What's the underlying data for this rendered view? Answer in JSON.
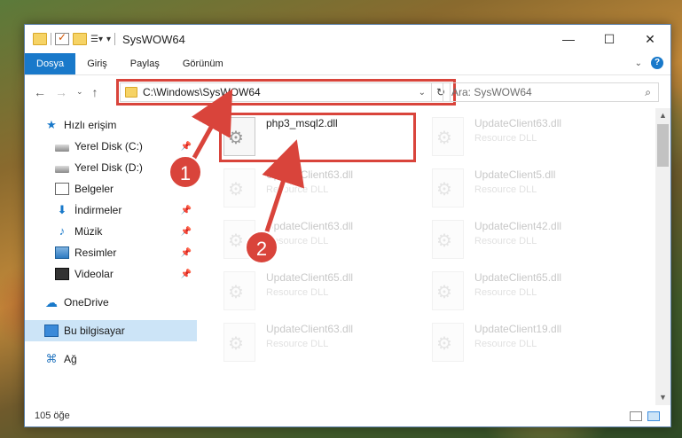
{
  "window": {
    "title": "SysWOW64"
  },
  "ribbon": {
    "tabs": [
      "Dosya",
      "Giriş",
      "Paylaş",
      "Görünüm"
    ],
    "help": "?"
  },
  "address": {
    "path": "C:\\Windows\\SysWOW64"
  },
  "search": {
    "placeholder": "Ara: SysWOW64"
  },
  "sidebar": {
    "items": [
      {
        "label": "Hızlı erişim",
        "icon": "star-icon"
      },
      {
        "label": "Yerel Disk (C:)",
        "icon": "drive-icon",
        "pinned": true
      },
      {
        "label": "Yerel Disk (D:)",
        "icon": "drive-icon"
      },
      {
        "label": "Belgeler",
        "icon": "documents-icon"
      },
      {
        "label": "İndirmeler",
        "icon": "download-icon",
        "pinned": true
      },
      {
        "label": "Müzik",
        "icon": "music-icon",
        "pinned": true
      },
      {
        "label": "Resimler",
        "icon": "pictures-icon",
        "pinned": true
      },
      {
        "label": "Videolar",
        "icon": "video-icon",
        "pinned": true
      },
      {
        "label": "OneDrive",
        "icon": "cloud-icon"
      },
      {
        "label": "Bu bilgisayar",
        "icon": "pc-icon",
        "selected": true
      },
      {
        "label": "Ağ",
        "icon": "network-icon"
      }
    ]
  },
  "files": [
    {
      "name": "php3_msql2.dll",
      "type": "",
      "highlighted": true
    },
    {
      "name": "UpdateClient63.dll",
      "type": "Resource DLL"
    },
    {
      "name": "UpdateClient63.dll",
      "type": "Resource DLL"
    },
    {
      "name": "UpdateClient5.dll",
      "type": "Resource DLL"
    },
    {
      "name": "UpdateClient63.dll",
      "type": "Resource DLL"
    },
    {
      "name": "UpdateClient42.dll",
      "type": "Resource DLL"
    },
    {
      "name": "UpdateClient65.dll",
      "type": "Resource DLL"
    },
    {
      "name": "UpdateClient65.dll",
      "type": "Resource DLL"
    },
    {
      "name": "UpdateClient63.dll",
      "type": "Resource DLL"
    },
    {
      "name": "UpdateClient19.dll",
      "type": "Resource DLL"
    }
  ],
  "status": {
    "count": "105 öğe"
  },
  "markers": [
    "1",
    "2"
  ],
  "colors": {
    "accent": "#1979ca",
    "highlight": "#d9443b",
    "selected": "#cce4f7"
  }
}
